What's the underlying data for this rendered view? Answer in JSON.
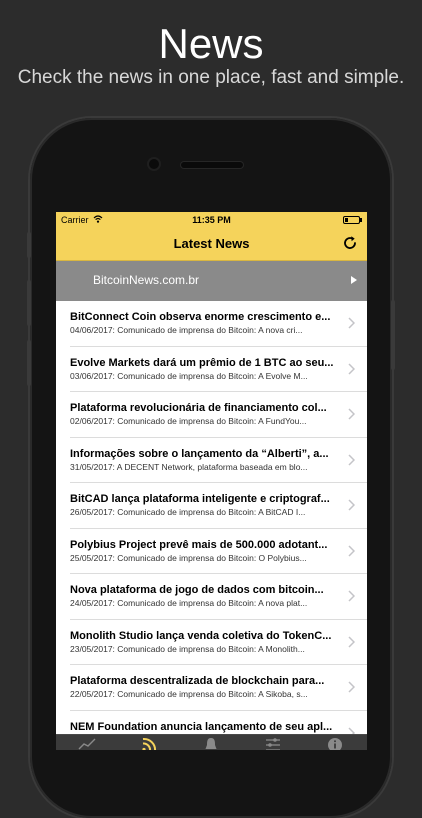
{
  "promo": {
    "title": "News",
    "subtitle": "Check the news in one place, fast and simple."
  },
  "status_bar": {
    "carrier": "Carrier",
    "time": "11:35 PM"
  },
  "nav": {
    "title": "Latest News",
    "refresh_icon": "refresh-icon"
  },
  "source": {
    "name": "BitcoinNews.com.br"
  },
  "news": [
    {
      "headline": "BitConnect Coin observa enorme crescimento e...",
      "summary": "04/06/2017: Comunicado de imprensa do Bitcoin: A nova cri..."
    },
    {
      "headline": "Evolve Markets dará um prêmio de 1 BTC ao seu...",
      "summary": "03/06/2017: Comunicado de imprensa do Bitcoin: A Evolve M..."
    },
    {
      "headline": "Plataforma revolucionária de financiamento col...",
      "summary": "02/06/2017: Comunicado de imprensa do Bitcoin: A FundYou..."
    },
    {
      "headline": "Informações sobre o lançamento da “Alberti”, a...",
      "summary": "31/05/2017: A DECENT Network, plataforma baseada em blo..."
    },
    {
      "headline": "BitCAD lança plataforma inteligente e criptograf...",
      "summary": "26/05/2017: Comunicado de imprensa do Bitcoin: A BitCAD I..."
    },
    {
      "headline": "Polybius Project prevê mais de 500.000 adotant...",
      "summary": "25/05/2017: Comunicado de imprensa do Bitcoin: O Polybius..."
    },
    {
      "headline": "Nova plataforma de jogo de dados com bitcoin...",
      "summary": "24/05/2017: Comunicado de imprensa do Bitcoin: A nova plat..."
    },
    {
      "headline": "Monolith Studio lança venda coletiva do TokenC...",
      "summary": "23/05/2017: Comunicado de imprensa do Bitcoin: A Monolith..."
    },
    {
      "headline": "Plataforma descentralizada de blockchain para...",
      "summary": "22/05/2017: Comunicado de imprensa do Bitcoin: A Sikoba, s..."
    },
    {
      "headline": "NEM Foundation anuncia lançamento de seu apl...",
      "summary": ""
    }
  ],
  "tabs": [
    {
      "icon": "chart-icon",
      "active": false
    },
    {
      "icon": "rss-feed-icon",
      "active": true
    },
    {
      "icon": "bell-icon",
      "active": false
    },
    {
      "icon": "sliders-icon",
      "active": false
    },
    {
      "icon": "info-icon",
      "active": false
    }
  ],
  "colors": {
    "accent": "#f5d35b",
    "background": "#2c2c2c",
    "source_bar": "#8a8a8a"
  }
}
